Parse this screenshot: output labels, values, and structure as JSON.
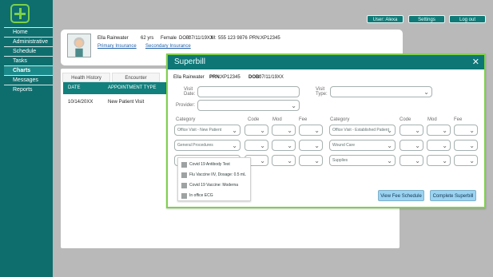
{
  "sidebar": {
    "items": [
      {
        "label": "Home"
      },
      {
        "label": "Administrative"
      },
      {
        "label": "Schedule"
      },
      {
        "label": "Tasks"
      },
      {
        "label": "Charts"
      },
      {
        "label": "Messages"
      },
      {
        "label": "Reports"
      }
    ],
    "active_index": 4
  },
  "topbar": {
    "user_button": "User: Alexa",
    "settings_button": "Settings",
    "logout_button": "Log out"
  },
  "patient": {
    "name": "Ella Rainwater",
    "age": "62 yrs",
    "gender": "Female",
    "dob_label": "DOB:",
    "dob": "07/11/19XX",
    "m_label": "M:",
    "m": "555 123 9876",
    "prn_label": "PRN:",
    "prn": "XP12345",
    "primary_insurance": "Primary Insurance",
    "secondary_insurance": "Secondary Insurance"
  },
  "tabs": {
    "health_history": "Health History",
    "encounter": "Encounter"
  },
  "table": {
    "headers": [
      "DATE",
      "APPOINTMENT TYPE"
    ],
    "rows": [
      [
        "10/14/20XX",
        "New Patient Visit"
      ]
    ]
  },
  "modal": {
    "title": "Superbill",
    "close": "✕",
    "patient_name": "Ella Rainwater",
    "prn_label": "PRN:",
    "prn": "XP12345",
    "dob_label": "DOB:",
    "dob": "07/11/19XX",
    "visit_date_label": "Visit Date:",
    "visit_type_label": "Visit Type:",
    "provider_label": "Provider:",
    "headers": {
      "category": "Category",
      "code": "Code",
      "mod": "Mod",
      "fee": "Fee"
    },
    "left_rows": [
      {
        "category": "Office Visit - New Patient"
      },
      {
        "category": "General Procedures"
      },
      {
        "category": ""
      }
    ],
    "right_rows": [
      {
        "category": "Office Visit - Established Patient"
      },
      {
        "category": "Wound Care"
      },
      {
        "category": "Supplies"
      }
    ],
    "buttons": {
      "view_fee_schedule": "View Fee Schedule",
      "complete_superbill": "Complete Superbill"
    }
  },
  "dropdown": {
    "options": [
      {
        "label": "Covid 19 Antibody Test"
      },
      {
        "label": "Flu Vaccine IIV, Dosage: 0.5 mL"
      },
      {
        "label": "Covid 19 Vaccine: Moderna"
      },
      {
        "label": "In office ECG"
      }
    ]
  },
  "colors": {
    "brand_teal": "#0f7676",
    "accent_green": "#80d04d",
    "link_blue": "#1f5fa8",
    "button_blue": "#9bd4f2"
  }
}
